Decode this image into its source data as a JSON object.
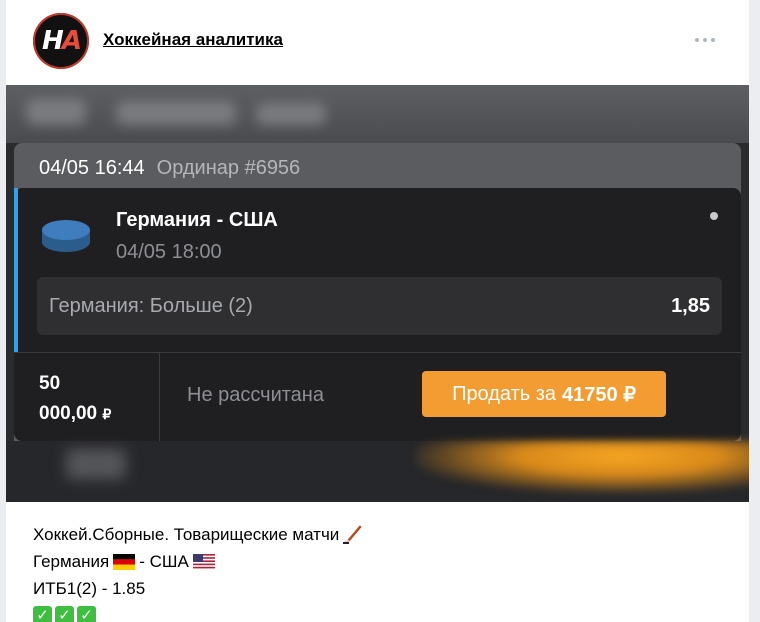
{
  "channel": {
    "name": "Хоккейная аналитика",
    "avatar_text_1": "H",
    "avatar_text_2": "A"
  },
  "bet": {
    "datetime": "04/05 16:44",
    "type": "Ординар #6956",
    "match": "Германия - США",
    "match_time": "04/05 18:00",
    "outcome": "Германия: Больше (2)",
    "odds": "1,85",
    "stake_line1": "50",
    "stake_line2": "000,00",
    "currency": "₽",
    "status": "Не рассчитана",
    "sell_label": "Продать за",
    "sell_amount": "41750 ₽"
  },
  "post": {
    "line1": "Хоккей.Сборные. Товарищеские матчи",
    "line2_a": "Германия",
    "line2_b": "- США",
    "line3": "ИТБ1(2) - 1.85",
    "checks": [
      "✓",
      "✓",
      "✓"
    ]
  },
  "colors": {
    "accent": "#2ea3f2",
    "sell_button": "#f39c32",
    "check_green": "#3fbf3f"
  },
  "icons": [
    "more-dots-icon",
    "hockey-puck-icon",
    "hockey-stick-icon",
    "flag-germany-icon",
    "flag-usa-icon",
    "checkmark-icon"
  ]
}
